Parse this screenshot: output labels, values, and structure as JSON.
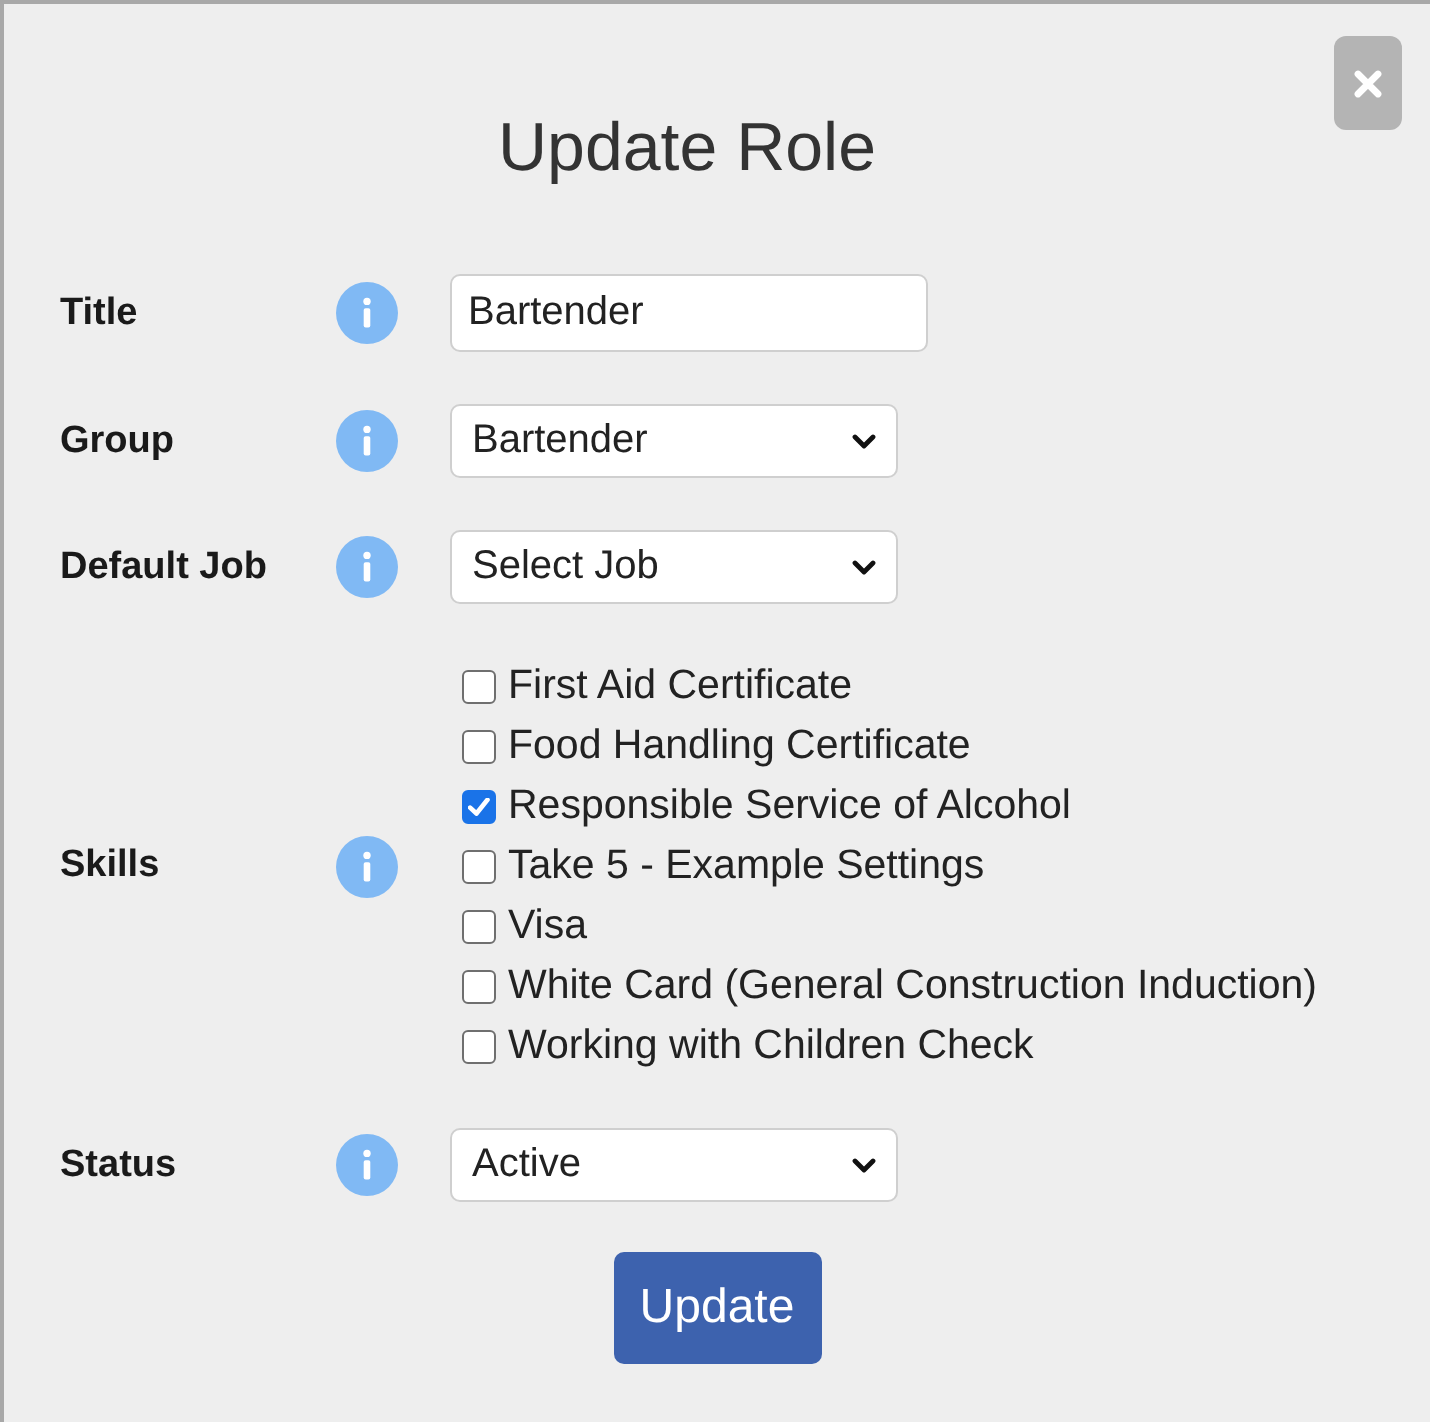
{
  "dialog": {
    "title": "Update Role"
  },
  "fields": [
    {
      "kind": "text",
      "label": "Title",
      "value": "Bartender"
    },
    {
      "kind": "select",
      "label": "Group",
      "value": "Bartender"
    },
    {
      "kind": "select",
      "label": "Default Job",
      "value": "Select Job"
    },
    {
      "kind": "checklist",
      "label": "Skills",
      "options": [
        {
          "label": "First Aid Certificate",
          "checked": false
        },
        {
          "label": "Food Handling Certificate",
          "checked": false
        },
        {
          "label": "Responsible Service of Alcohol",
          "checked": true
        },
        {
          "label": "Take 5 - Example Settings",
          "checked": false
        },
        {
          "label": "Visa",
          "checked": false
        },
        {
          "label": "White Card (General Construction Induction)",
          "checked": false
        },
        {
          "label": "Working with Children Check",
          "checked": false
        }
      ]
    },
    {
      "kind": "select",
      "label": "Status",
      "value": "Active"
    }
  ],
  "submit_button": "Update"
}
